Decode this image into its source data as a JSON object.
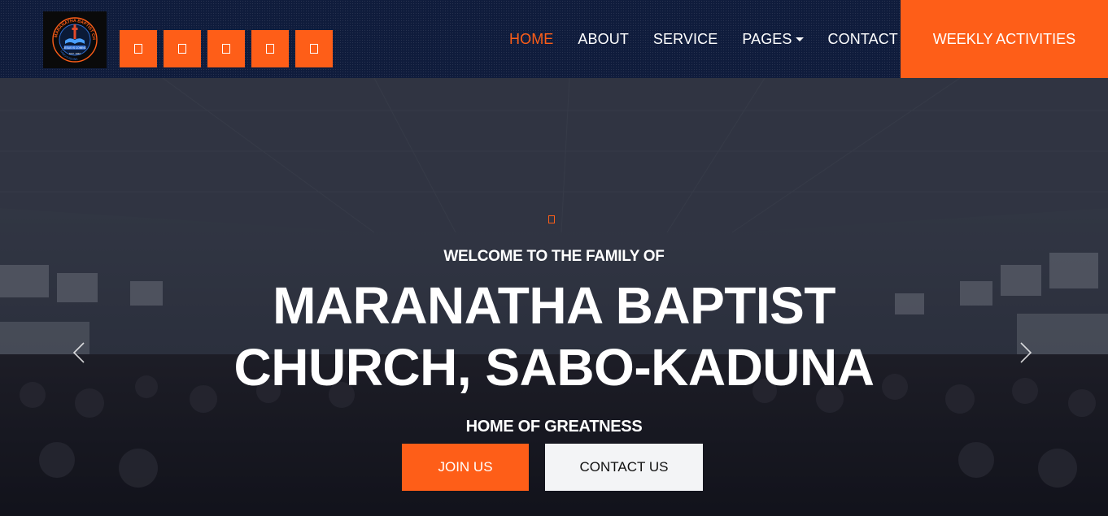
{
  "header": {
    "logo": {
      "ring_text": "MARANATHA BAPTIST CHURCH",
      "banner_text": "JESUS IS COMING",
      "est_text": "EST. 1962",
      "bottom_text": "SABO-KADUNA"
    },
    "social_icons": [
      "social-icon-1",
      "social-icon-2",
      "social-icon-3",
      "social-icon-4",
      "social-icon-5"
    ],
    "nav": {
      "home": "HOME",
      "about": "ABOUT",
      "service": "SERVICE",
      "pages": "PAGES",
      "contact": "CONTACT"
    },
    "cta_label": "WEEKLY ACTIVITIES"
  },
  "hero": {
    "eyebrow": "WELCOME TO THE FAMILY OF",
    "title_line1": "MARANATHA BAPTIST",
    "title_line2": "CHURCH, SABO-KADUNA",
    "tagline": "HOME OF GREATNESS",
    "join_label": "JOIN US",
    "contact_label": "CONTACT US"
  },
  "colors": {
    "accent": "#fe5e18",
    "navbar": "#0f1c3c",
    "button_light": "#f3f4f6"
  }
}
